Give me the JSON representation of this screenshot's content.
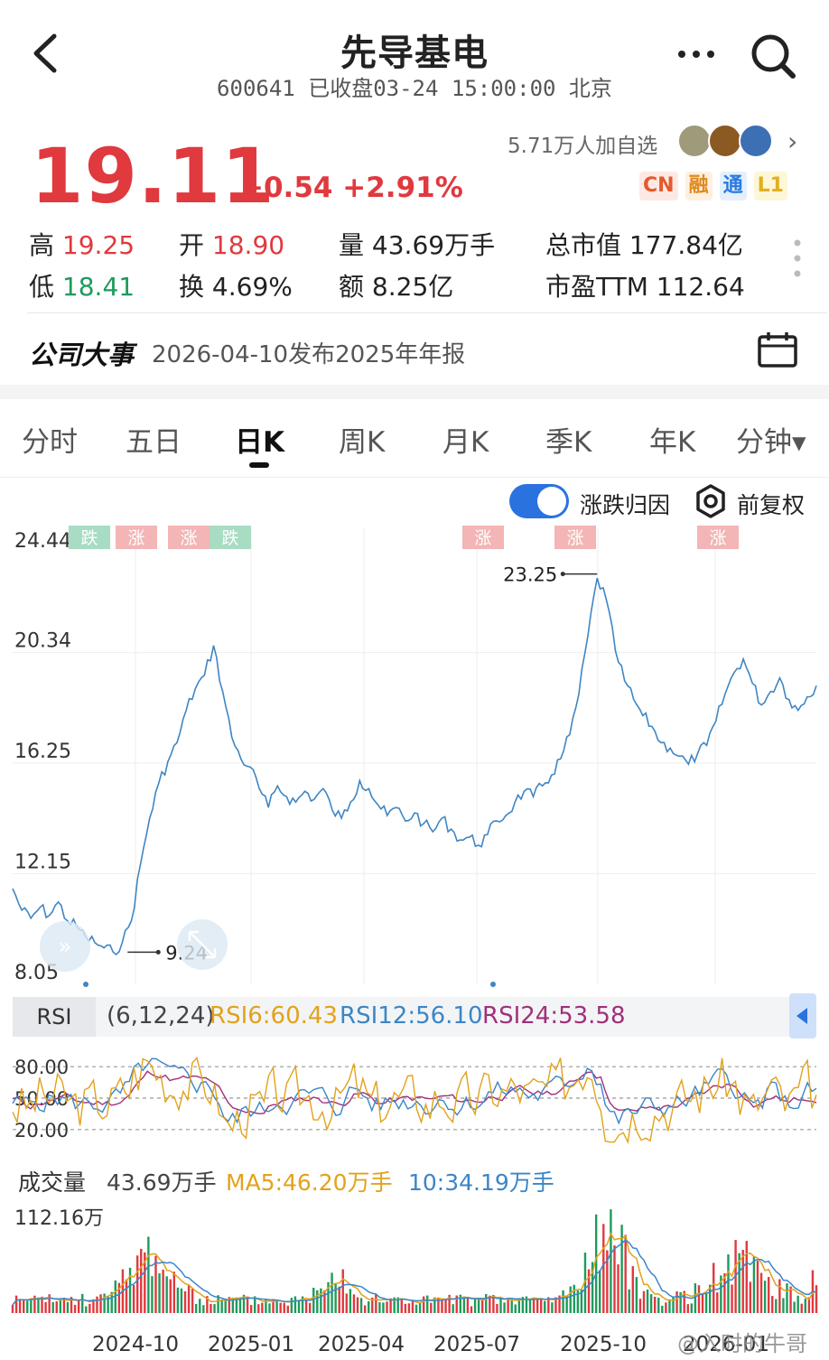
{
  "header": {
    "title": "先导基电",
    "subtitle": "600641 已收盘03-24 15:00:00 北京"
  },
  "quote": {
    "price": "19.11",
    "change": "+0.54 +2.91%",
    "followers": "5.71万人加自选",
    "badges": [
      "CN",
      "融",
      "通",
      "L1"
    ],
    "high_label": "高",
    "high": "19.25",
    "open_label": "开",
    "open": "18.90",
    "volume_label": "量",
    "volume": "43.69万手",
    "mcap_label": "总市值",
    "mcap": "177.84亿",
    "low_label": "低",
    "low": "18.41",
    "turnover_label": "换",
    "turnover": "4.69%",
    "amount_label": "额",
    "amount": "8.25亿",
    "pe_label": "市盈TTM",
    "pe": "112.64"
  },
  "event": {
    "label": "公司大事",
    "text": "2026-04-10发布2025年年报"
  },
  "tabs": [
    "分时",
    "五日",
    "日K",
    "周K",
    "月K",
    "季K",
    "年K",
    "分钟▾"
  ],
  "active_tab": "日K",
  "chart_controls": {
    "toggle_label": "涨跌归因",
    "adjust_label": "前复权"
  },
  "colors": {
    "up": "#e0393e",
    "down": "#1f9a5c",
    "accent": "#2a72e0",
    "rsi6": "#e2a21b",
    "rsi12": "#3a86c8",
    "rsi24": "#a0307a"
  },
  "chart_data": {
    "type": "line",
    "price_axis": [
      "24.44",
      "20.34",
      "16.25",
      "12.15",
      "8.05"
    ],
    "ylim": [
      8.05,
      24.44
    ],
    "x_ticks": [
      "2024-10",
      "2025-01",
      "2025-04",
      "2025-07",
      "2025-10",
      "2026-01"
    ],
    "max_label": "23.25",
    "min_label": "9.24",
    "tags": [
      "跌",
      "涨",
      "涨",
      "跌",
      "涨",
      "涨",
      "涨"
    ],
    "price_series": [
      11.6,
      10.8,
      10.5,
      10.9,
      10.6,
      11.1,
      10.4,
      10.2,
      9.8,
      9.6,
      9.4,
      9.24,
      9.6,
      10.4,
      12.5,
      14.2,
      15.5,
      16.3,
      17.0,
      18.2,
      19.0,
      19.5,
      20.6,
      18.9,
      17.2,
      16.4,
      16.1,
      15.3,
      14.6,
      15.4,
      15.0,
      14.8,
      15.2,
      14.9,
      15.3,
      14.5,
      14.2,
      14.8,
      15.6,
      15.3,
      14.7,
      14.3,
      14.6,
      14.1,
      14.4,
      14.0,
      13.7,
      14.2,
      13.8,
      13.4,
      13.5,
      13.2,
      13.6,
      14.1,
      14.3,
      14.8,
      15.2,
      15.0,
      15.4,
      15.8,
      16.4,
      17.3,
      18.8,
      21.0,
      23.1,
      22.3,
      20.4,
      19.3,
      18.6,
      18.0,
      17.6,
      17.0,
      16.8,
      16.5,
      16.2,
      16.6,
      16.9,
      17.8,
      18.8,
      19.6,
      20.1,
      19.2,
      18.4,
      18.9,
      19.4,
      18.6,
      18.2,
      18.7,
      19.11
    ],
    "rsi": {
      "params": "(6,12,24)",
      "rsi6_label": "RSI6:60.43",
      "rsi12_label": "RSI12:56.10",
      "rsi24_label": "RSI24:53.58",
      "levels": [
        "80.00",
        "50.00",
        "20.00"
      ]
    },
    "volume": {
      "label": "成交量",
      "value": "43.69万手",
      "ma5_label": "MA5:46.20万手",
      "ma10_label": "10:34.19万手",
      "max_label": "112.16万"
    }
  },
  "watermark": "@入时的牛哥",
  "icons": [
    "back-arrow-icon",
    "more-dots-icon",
    "search-icon",
    "calendar-icon",
    "settings-gear-icon"
  ]
}
